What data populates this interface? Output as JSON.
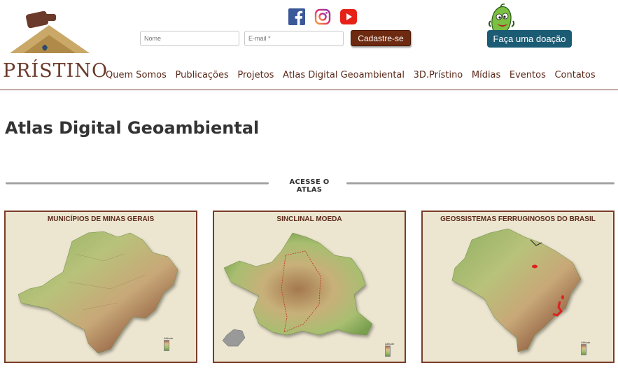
{
  "brand": {
    "name": "PRÍSTINO"
  },
  "signup": {
    "name_placeholder": "Nome",
    "email_placeholder": "E-mail *",
    "submit_label": "Cadastre-se"
  },
  "social": [
    "facebook-icon",
    "instagram-icon",
    "youtube-icon"
  ],
  "donate": {
    "label": "Faça uma doação"
  },
  "nav": {
    "items": [
      "Quem Somos",
      "Publicações",
      "Projetos",
      "Atlas Digital Geoambiental",
      "3D.Prístino",
      "Mídias",
      "Eventos",
      "Contatos"
    ]
  },
  "page": {
    "title": "Atlas Digital Geoambiental"
  },
  "section": {
    "label": "ACESSE O ATLAS"
  },
  "cards": [
    {
      "title": "MUNICÍPIOS DE MINAS GERAIS",
      "legend": "Altitude"
    },
    {
      "title": "SINCLINAL MOEDA",
      "legend": "Altitude"
    },
    {
      "title": "GEOSSISTEMAS FERRUGINOSOS DO BRASIL",
      "legend": "Altitude"
    }
  ],
  "colors": {
    "brand_brown": "#6b3a2a",
    "submit_bg": "#6e2a10",
    "donate_bg": "#1b5b74",
    "card_border": "#7a3c28",
    "card_bg": "#ece5d0"
  }
}
